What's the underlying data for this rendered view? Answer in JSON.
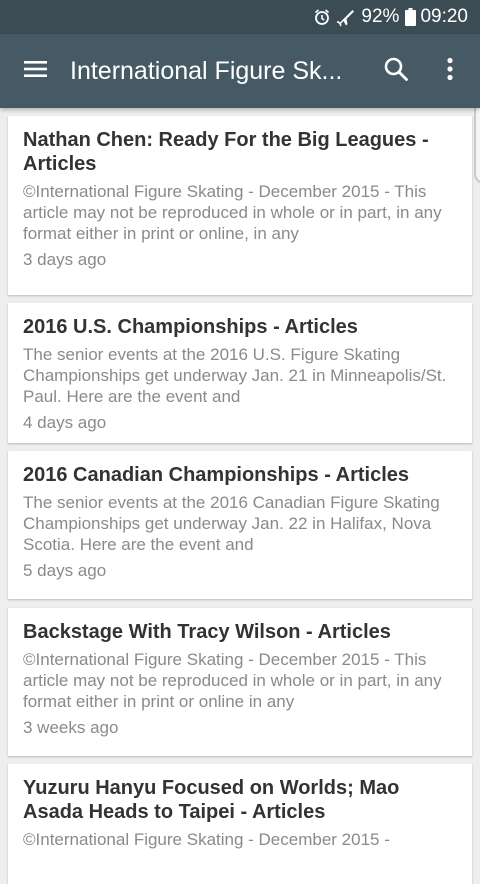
{
  "status_bar": {
    "battery": "92%",
    "time": "09:20"
  },
  "app_bar": {
    "title": "International Figure Sk...",
    "menu_icon": "hamburger-menu-icon",
    "search_icon": "search-icon",
    "more_icon": "more-vert-icon"
  },
  "articles": [
    {
      "title": "Nathan Chen: Ready For the Big Leagues - Articles",
      "snippet": "©International Figure Skating - December 2015 - This article may not be reproduced in whole or in part, in any format either in print or online, in any",
      "time": "3 days ago"
    },
    {
      "title": "2016 U.S. Championships - Articles",
      "snippet": "The senior events at the 2016 U.S. Figure Skating Championships get underway Jan. 21 in Minneapolis/St. Paul. Here are the event and",
      "time": "4 days ago"
    },
    {
      "title": "2016 Canadian Championships - Articles",
      "snippet": "The senior events at the 2016 Canadian Figure Skating Championships get underway Jan. 22 in Halifax, Nova Scotia. Here are the event and",
      "time": "5 days ago"
    },
    {
      "title": "Backstage With Tracy Wilson - Articles",
      "snippet": "©International Figure Skating - December 2015 - This article may not be reproduced in whole or in part, in any format either in print or online in any",
      "time": "3 weeks ago"
    },
    {
      "title": "Yuzuru Hanyu Focused on Worlds; Mao Asada Heads to Taipei - Articles",
      "snippet": "©International Figure Skating - December 2015 -",
      "time": ""
    }
  ]
}
